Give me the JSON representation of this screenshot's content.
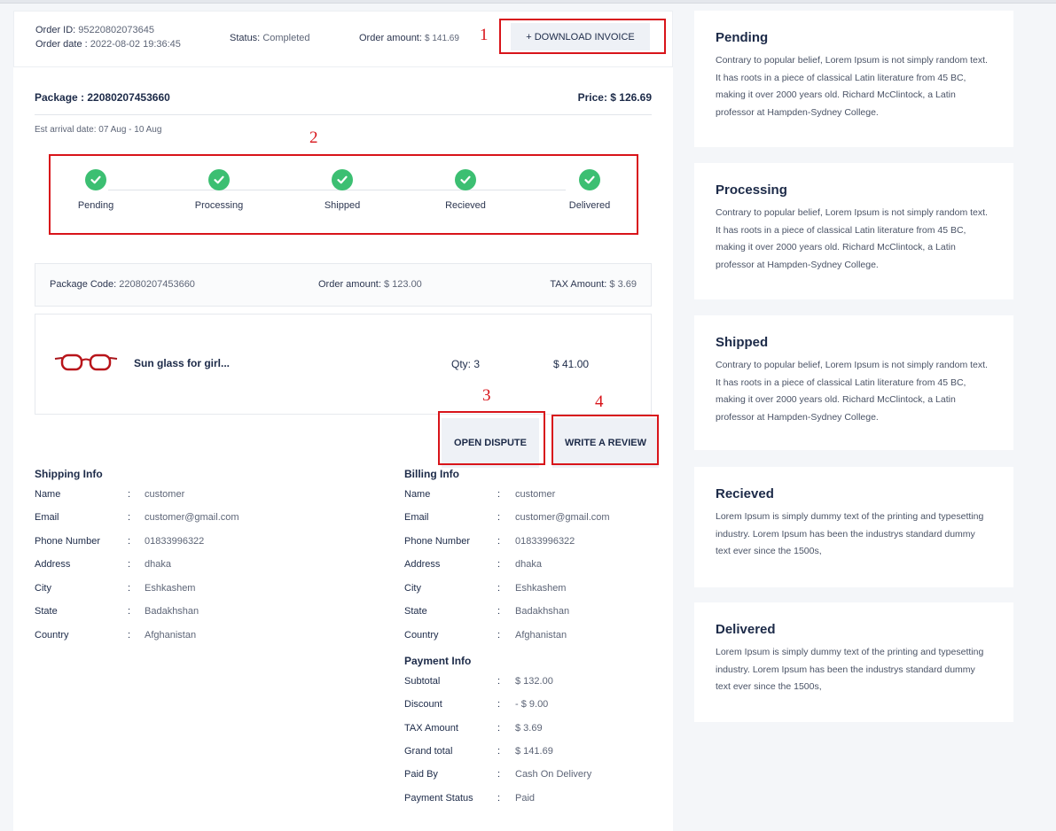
{
  "order": {
    "id_label": "Order ID:",
    "id": "95220802073645",
    "date_label": "Order date :",
    "date": "2022-08-02 19:36:45",
    "status_label": "Status:",
    "status": "Completed",
    "amount_label": "Order amount:",
    "amount": "$ 141.69",
    "download_invoice": "+ DOWNLOAD INVOICE"
  },
  "package": {
    "title": "Package : 22080207453660",
    "price": "Price: $ 126.69",
    "est_arrival": "Est arrival date: 07 Aug - 10 Aug",
    "steps": [
      "Pending",
      "Processing",
      "Shipped",
      "Recieved",
      "Delivered"
    ],
    "code_label": "Package Code:",
    "code": "22080207453660",
    "amount_label": "Order amount:",
    "amount": "$ 123.00",
    "tax_label": "TAX Amount:",
    "tax": "$ 3.69"
  },
  "item": {
    "name": "Sun glass for girl...",
    "qty": "Qty: 3",
    "price": "$ 41.00"
  },
  "actions": {
    "open_dispute": "OPEN DISPUTE",
    "write_review": "WRITE A REVIEW"
  },
  "annotations": [
    "1",
    "2",
    "3",
    "4"
  ],
  "shipping": {
    "title": "Shipping Info",
    "rows": [
      {
        "label": "Name",
        "value": "customer"
      },
      {
        "label": "Email",
        "value": "customer@gmail.com"
      },
      {
        "label": "Phone Number",
        "value": "01833996322"
      },
      {
        "label": "Address",
        "value": "dhaka"
      },
      {
        "label": "City",
        "value": "Eshkashem"
      },
      {
        "label": "State",
        "value": "Badakhshan"
      },
      {
        "label": "Country",
        "value": "Afghanistan"
      }
    ]
  },
  "billing": {
    "title": "Billing Info",
    "rows": [
      {
        "label": "Name",
        "value": "customer"
      },
      {
        "label": "Email",
        "value": "customer@gmail.com"
      },
      {
        "label": "Phone Number",
        "value": "01833996322"
      },
      {
        "label": "Address",
        "value": "dhaka"
      },
      {
        "label": "City",
        "value": "Eshkashem"
      },
      {
        "label": "State",
        "value": "Badakhshan"
      },
      {
        "label": "Country",
        "value": "Afghanistan"
      }
    ]
  },
  "payment": {
    "title": "Payment Info",
    "rows": [
      {
        "label": "Subtotal",
        "value": "$ 132.00"
      },
      {
        "label": "Discount",
        "value": "- $ 9.00"
      },
      {
        "label": "TAX Amount",
        "value": "$ 3.69"
      },
      {
        "label": "Grand total",
        "value": "$ 141.69"
      },
      {
        "label": "Paid By",
        "value": "Cash On Delivery"
      },
      {
        "label": "Payment Status",
        "value": "Paid"
      }
    ]
  },
  "colon": ":",
  "side": [
    {
      "title": "Pending",
      "text": "Contrary to popular belief, Lorem Ipsum is not simply random text. It has roots in a piece of classical Latin literature from 45 BC, making it over 2000 years old. Richard McClintock, a Latin professor at Hampden-Sydney College."
    },
    {
      "title": "Processing",
      "text": "Contrary to popular belief, Lorem Ipsum is not simply random text. It has roots in a piece of classical Latin literature from 45 BC, making it over 2000 years old. Richard McClintock, a Latin professor at Hampden-Sydney College."
    },
    {
      "title": "Shipped",
      "text": "Contrary to popular belief, Lorem Ipsum is not simply random text. It has roots in a piece of classical Latin literature from 45 BC, making it over 2000 years old. Richard McClintock, a Latin professor at Hampden-Sydney College."
    },
    {
      "title": "Recieved",
      "text": "Lorem Ipsum is simply dummy text of the printing and typesetting industry. Lorem Ipsum has been the industrys standard dummy text ever since the 1500s,"
    },
    {
      "title": "Delivered",
      "text": "Lorem Ipsum is simply dummy text of the printing and typesetting industry. Lorem Ipsum has been the industrys standard dummy text ever since the 1500s,"
    }
  ],
  "colors": {
    "accent_green": "#3cbf72",
    "annotation_red": "#d8141a",
    "text_dark": "#1c2a48"
  }
}
